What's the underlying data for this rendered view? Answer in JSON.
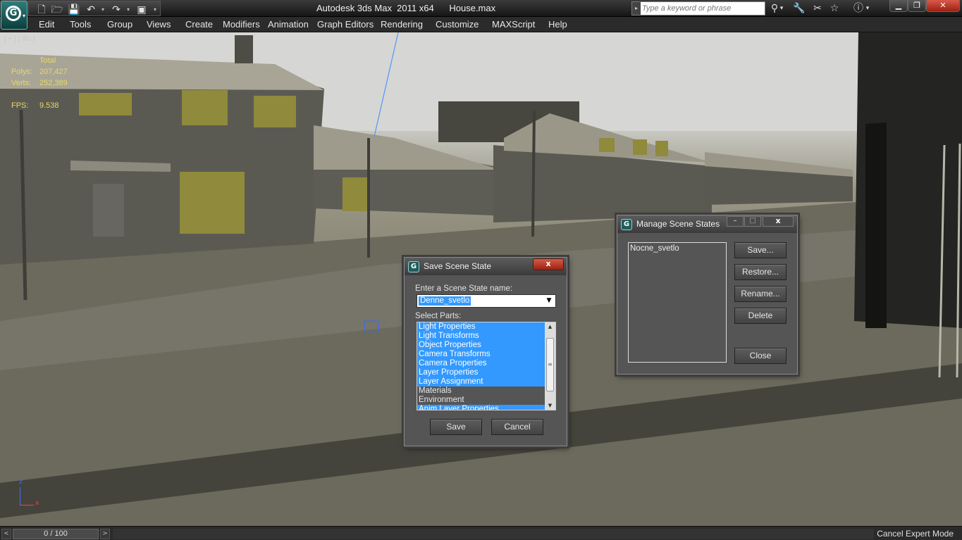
{
  "app": {
    "window_title": "Autodesk 3ds Max  2011 x64      House.max",
    "logo_letter": "G",
    "search_placeholder": "Type a keyword or phrase"
  },
  "toolbar_icons": [
    "new-icon",
    "open-icon",
    "save-icon",
    "undo-icon",
    "redo-icon",
    "project-folder-icon"
  ],
  "right_icons": [
    "binoculars-icon",
    "wrench-icon",
    "tools-icon",
    "star-icon",
    "help-icon"
  ],
  "window_buttons": {
    "minimize": "▁",
    "maximize": "❐",
    "close": "✕"
  },
  "menu": [
    "Edit",
    "Tools",
    "Group",
    "Views",
    "Create",
    "Modifiers",
    "Animation",
    "Graph Editors",
    "Rendering",
    "Customize",
    "MAXScript",
    "Help"
  ],
  "viewport": {
    "label": "[ + ] [ Illu ]",
    "stats_header": "Total",
    "polys_label": "Polys:",
    "polys_value": "207,427",
    "verts_label": "Verts:",
    "verts_value": "252,389",
    "fps_label": "FPS:",
    "fps_value": "9.538",
    "axis_z": "z",
    "axis_x": "x"
  },
  "save_dialog": {
    "title": "Save Scene State",
    "name_label": "Enter a Scene State name:",
    "name_value": "Denne_svetlo",
    "parts_label": "Select Parts:",
    "parts": [
      {
        "label": "Light Properties",
        "selected": true
      },
      {
        "label": "Light Transforms",
        "selected": true
      },
      {
        "label": "Object Properties",
        "selected": true
      },
      {
        "label": "Camera Transforms",
        "selected": true
      },
      {
        "label": "Camera Properties",
        "selected": true
      },
      {
        "label": "Layer Properties",
        "selected": true
      },
      {
        "label": "Layer Assignment",
        "selected": true
      },
      {
        "label": "Materials",
        "selected": false
      },
      {
        "label": "Environment",
        "selected": false
      },
      {
        "label": "Anim Layer Properties",
        "selected": true
      }
    ],
    "save_button": "Save",
    "cancel_button": "Cancel",
    "close_glyph": "x"
  },
  "manage_dialog": {
    "title": "Manage Scene States",
    "states": [
      "Nocne_svetlo"
    ],
    "save_button": "Save...",
    "restore_button": "Restore...",
    "rename_button": "Rename...",
    "delete_button": "Delete",
    "close_button": "Close",
    "minimize_glyph": "–",
    "maximize_glyph": "□",
    "close_glyph": "x"
  },
  "timeline": {
    "frame_display": "0 / 100",
    "prev": "<",
    "next": ">"
  },
  "status": {
    "cancel_expert_mode": "Cancel Expert Mode"
  }
}
